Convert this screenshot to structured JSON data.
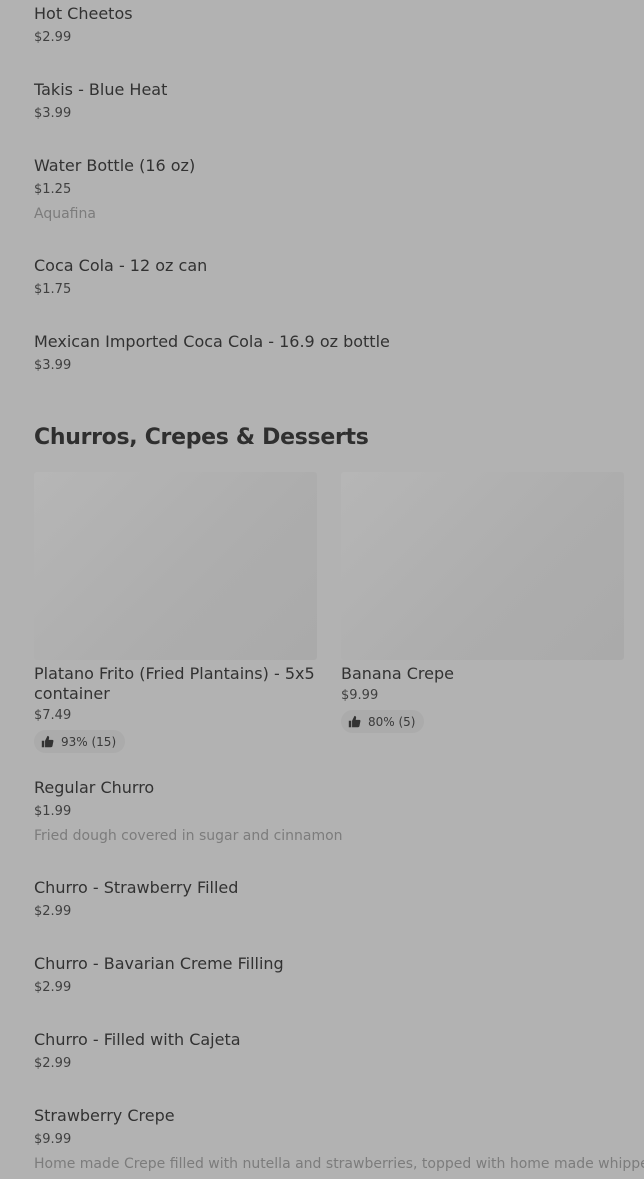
{
  "top_items": [
    {
      "name": "Hot Cheetos",
      "price": "$2.99"
    },
    {
      "name": "Takis - Blue Heat",
      "price": "$3.99"
    },
    {
      "name": "Water Bottle (16 oz)",
      "price": "$1.25",
      "description": "Aquafina"
    },
    {
      "name": "Coca Cola - 12 oz can",
      "price": "$1.75"
    },
    {
      "name": "Mexican Imported Coca Cola - 16.9 oz bottle",
      "price": "$3.99"
    }
  ],
  "section": {
    "title": "Churros, Crepes & Desserts",
    "cards": [
      {
        "name": "Platano Frito (Fried Plantains) - 5x5 container",
        "price": "$7.49",
        "rating": "93% (15)"
      },
      {
        "name": "Banana Crepe",
        "price": "$9.99",
        "rating": "80% (5)"
      }
    ],
    "items": [
      {
        "name": "Regular Churro",
        "price": "$1.99",
        "description": "Fried dough covered in sugar and cinnamon"
      },
      {
        "name": "Churro - Strawberry Filled",
        "price": "$2.99"
      },
      {
        "name": "Churro - Bavarian Creme Filling",
        "price": "$2.99"
      },
      {
        "name": "Churro - Filled with Cajeta",
        "price": "$2.99"
      },
      {
        "name": "Strawberry Crepe",
        "price": "$9.99",
        "description": "Home made Crepe filled with nutella and strawberries, topped with home made whipped"
      }
    ]
  },
  "icons": {
    "rating": "thumbs-up-icon"
  },
  "colors": {
    "background": "#b2b2b2",
    "text": "#323232",
    "muted": "#7c7c7c",
    "badge": "#ababab"
  }
}
